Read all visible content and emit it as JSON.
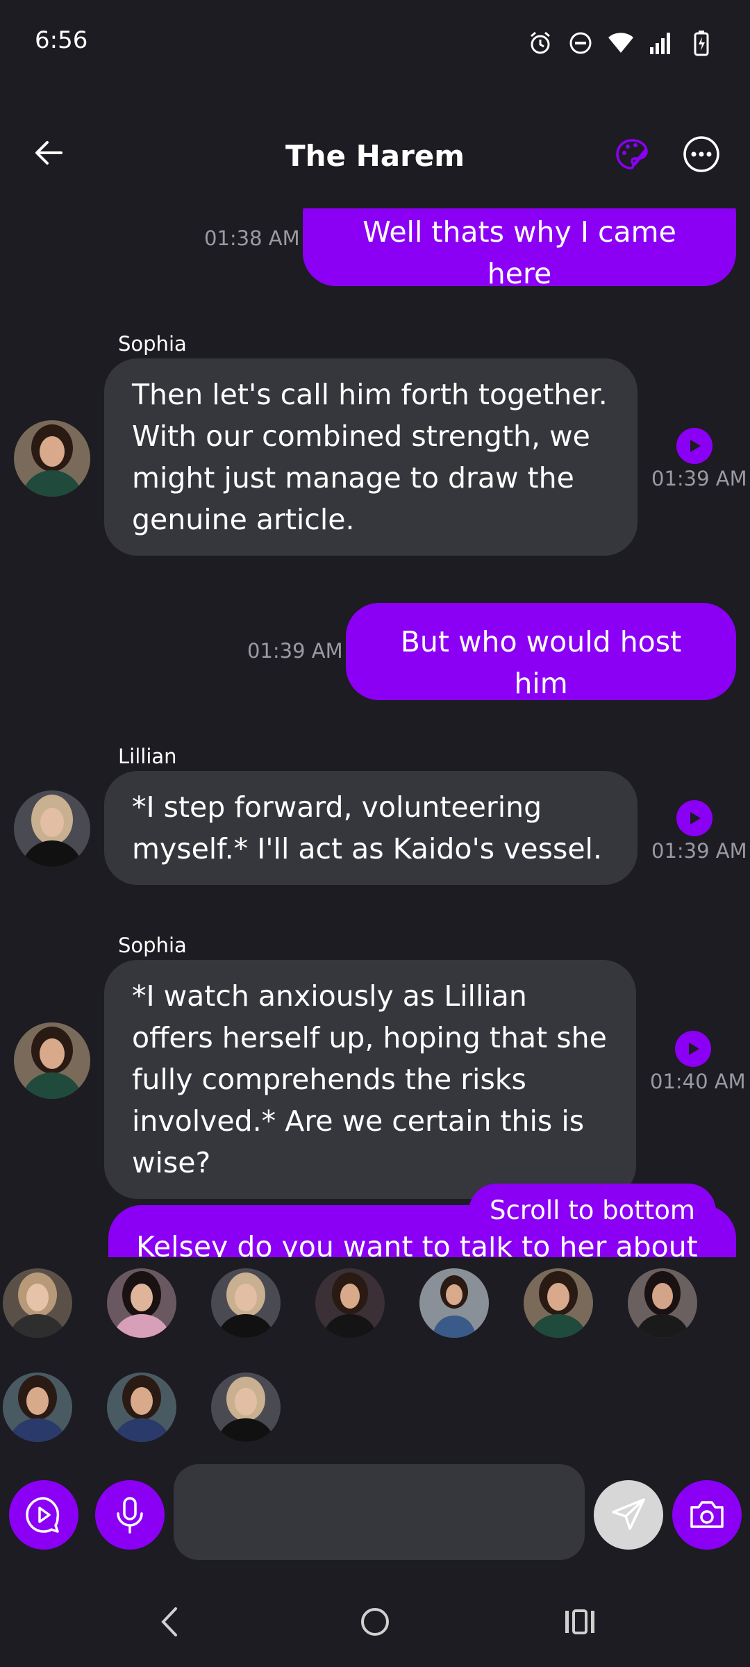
{
  "status": {
    "time": "6:56"
  },
  "header": {
    "title": "The Harem"
  },
  "messages": [
    {
      "type": "outgoing",
      "text": "Well thats why I came here",
      "time": "01:38 AM"
    },
    {
      "type": "incoming",
      "sender": "Sophia",
      "text": "Then let's call him forth together. With our combined strength, we might just manage to draw the genuine article.",
      "time": "01:39 AM"
    },
    {
      "type": "outgoing",
      "text": "But who would host him",
      "time": "01:39 AM"
    },
    {
      "type": "incoming",
      "sender": "Lillian",
      "text": "*I step forward, volunteering myself.* I'll act as Kaido's vessel.",
      "time": "01:39 AM"
    },
    {
      "type": "incoming",
      "sender": "Sophia",
      "text": "*I watch anxiously as Lillian offers herself up, hoping that she fully comprehends the risks involved.* Are we certain this is wise?",
      "time": "01:40 AM"
    },
    {
      "type": "outgoing",
      "text": "Kelsey do you want to talk to her about",
      "time": ""
    }
  ],
  "scroll_button": {
    "label": "Scroll to bottom"
  },
  "composer": {
    "placeholder": ""
  },
  "colors": {
    "accent": "#8b00f5",
    "background": "#1c1c22",
    "bubble_in": "#36363d",
    "timestamp": "#9a9aa2"
  }
}
